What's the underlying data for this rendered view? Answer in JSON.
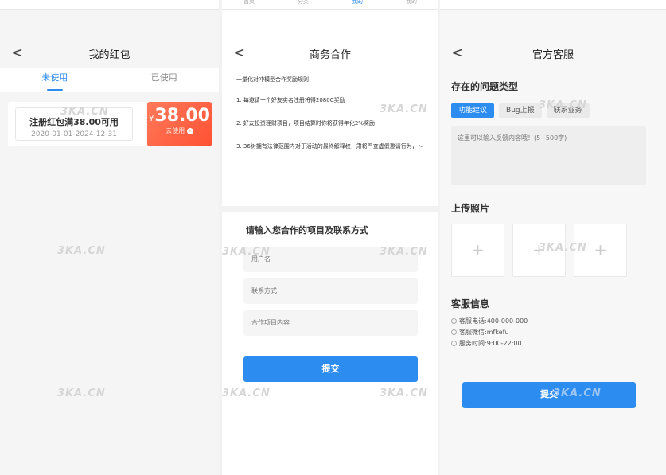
{
  "top_strip": {
    "tabs": [
      "首页",
      "分类",
      "我的",
      "我的"
    ]
  },
  "screen_coupons": {
    "title": "我的红包",
    "tabs": [
      {
        "label": "未使用",
        "active": true
      },
      {
        "label": "已使用",
        "active": false
      }
    ],
    "coupon": {
      "name": "注册红包满38.00可用",
      "validity": "2020-01-01-2024-12-31",
      "currency": "¥",
      "amount": "38.00",
      "action": "去使用"
    }
  },
  "screen_business": {
    "title": "商务合作",
    "rules_heading": "一量化对冲模型合作奖励规则",
    "rules": [
      "1. 每邀请一个好友实名注册将得2080C奖励",
      "2. 好友投资理财项目，项目结算时你将获得年化2%奖励",
      "3. 36树拥有法律范围内对于活动的最终解释权，肃将严查虚假邀请行为，～"
    ],
    "form_title": "请输入您合作的项目及联系方式",
    "fields": [
      {
        "placeholder": "用户名"
      },
      {
        "placeholder": "联系方式"
      },
      {
        "placeholder": "合作项目内容"
      }
    ],
    "submit_label": "提交"
  },
  "screen_service": {
    "title": "官方客服",
    "issue_section": "存在的问题类型",
    "issue_types": [
      {
        "label": "功能建议",
        "active": true
      },
      {
        "label": "Bug上报",
        "active": false
      },
      {
        "label": "联系业务",
        "active": false
      }
    ],
    "feedback_placeholder": "这里可以输入反馈内容哦！(5~500字)",
    "upload_section": "上传照片",
    "upload_glyph": "+",
    "contact_section": "客服信息",
    "contacts": [
      "客服电话:400-000-000",
      "客服微信:mfkefu",
      "服务时间:9:00-22:00"
    ],
    "submit_label": "提交"
  },
  "watermark": "3KA.CN",
  "colors": {
    "accent": "#2d8cf0",
    "coupon": "#ff5133"
  },
  "icons": {
    "back": "<"
  }
}
